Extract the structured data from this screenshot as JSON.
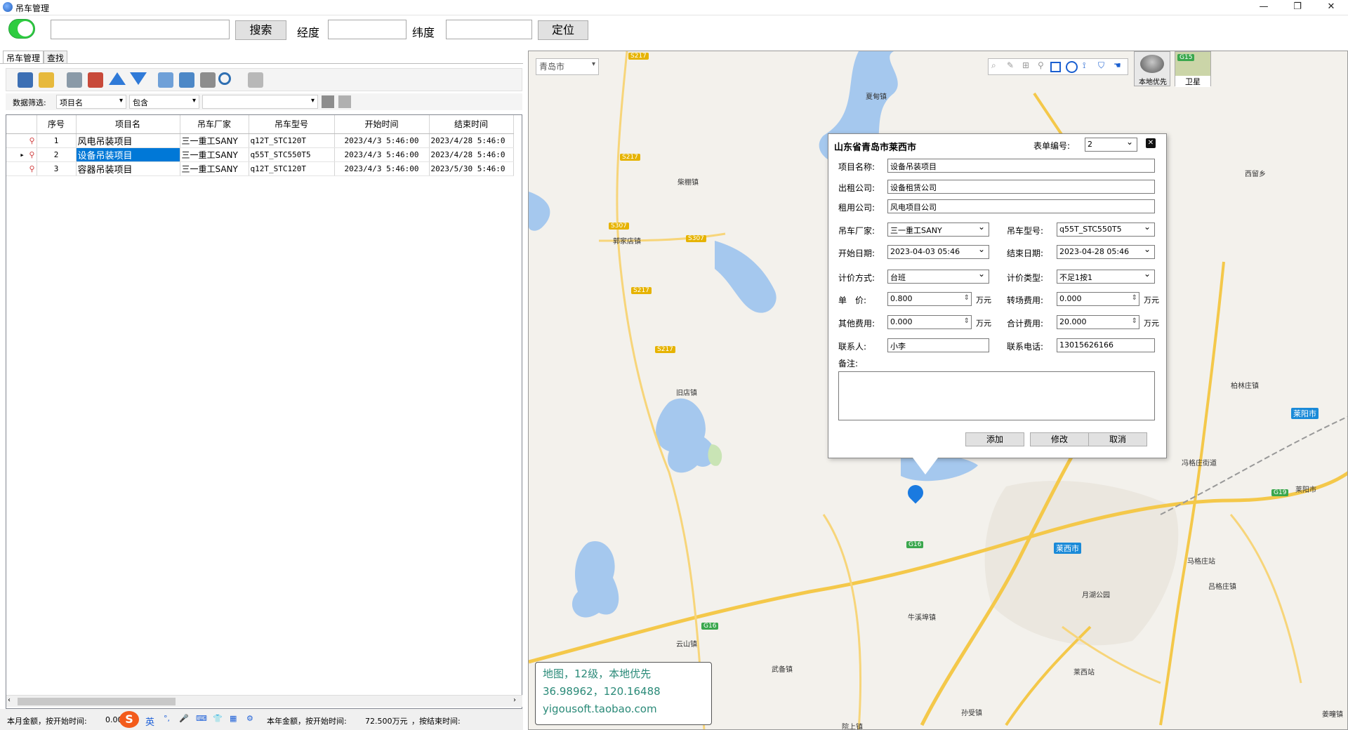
{
  "window": {
    "title": "吊车管理",
    "controls": [
      "—",
      "❐",
      "✕"
    ]
  },
  "toolbar": {
    "search_value": "",
    "search_button": "搜索",
    "lng_label": "经度",
    "lng_value": "",
    "lat_label": "纬度",
    "lat_value": "",
    "locate_button": "定位"
  },
  "tabs": [
    "吊车管理",
    "查找"
  ],
  "icon_toolbar": [
    "save-icon",
    "export-icon",
    "add-row-icon",
    "delete-row-icon",
    "move-up-icon",
    "move-down-icon",
    "refresh-icon",
    "sync-icon",
    "database-icon",
    "search-icon",
    "print-icon"
  ],
  "filter": {
    "label": "数据筛选:",
    "field": "项目名",
    "operator": "包含",
    "value": ""
  },
  "grid": {
    "columns": [
      "序号",
      "项目名",
      "吊车厂家",
      "吊车型号",
      "开始时间",
      "结束时间"
    ],
    "rows": [
      {
        "no": "1",
        "name": "风电吊装项目",
        "maker": "三一重工SANY",
        "model": "q12T_STC120T",
        "start": "2023/4/3 5:46:00",
        "end": "2023/4/28 5:46:0"
      },
      {
        "no": "2",
        "name": "设备吊装项目",
        "maker": "三一重工SANY",
        "model": "q55T_STC550T5",
        "start": "2023/4/3 5:46:00",
        "end": "2023/4/28 5:46:0"
      },
      {
        "no": "3",
        "name": "容器吊装项目",
        "maker": "三一重工SANY",
        "model": "q12T_STC120T",
        "start": "2023/4/3 5:46:00",
        "end": "2023/5/30 5:46:0"
      }
    ]
  },
  "status": {
    "month_label": "本月金额，按开始时间:",
    "month_value": "0.00",
    "year_label": "本年金额，按开始时间:",
    "year_value": "72.500万元",
    "end_label": "，按结束时间:",
    "ime": [
      "英",
      "°,",
      "🎤",
      "⌨",
      "👕",
      "▦",
      "⚙"
    ]
  },
  "map": {
    "city_select": "青岛市",
    "tools": [
      "zoom-icon",
      "ruler-icon",
      "measure-icon",
      "pin-icon",
      "rectangle-icon",
      "circle-icon",
      "polyline-icon",
      "shield-icon",
      "pan-icon"
    ],
    "local_first": "本地优先",
    "satellite": "卫星",
    "places": [
      "夏甸镇",
      "柴棚镇",
      "郭家店镇",
      "西留乡",
      "旧店镇",
      "柏林庄镇",
      "莱阳市",
      "冯格庄街道",
      "莱阳市",
      "莱西市",
      "马格庄站",
      "吕格庄镇",
      "月湖公园",
      "牛溪埠镇",
      "武备镇",
      "云山镇",
      "孙受镇",
      "莱西站",
      "院上镇",
      "姜疃镇"
    ],
    "info": {
      "line1": "地图，12级，本地优先",
      "line2": "36.98962，120.16488",
      "line3": "yigousoft.taobao.com"
    }
  },
  "dialog": {
    "title": "山东省青岛市莱西市",
    "form_no_label": "表单编号:",
    "form_no": "2",
    "project_label": "项目名称:",
    "project": "设备吊装项目",
    "lessor_label": "出租公司:",
    "lessor": "设备租赁公司",
    "lessee_label": "租用公司:",
    "lessee": "风电项目公司",
    "maker_label": "吊车厂家:",
    "maker": "三一重工SANY",
    "model_label": "吊车型号:",
    "model": "q55T_STC550T5",
    "start_label": "开始日期:",
    "start": "2023-04-03 05:46",
    "end_label": "结束日期:",
    "end": "2023-04-28 05:46",
    "pricing_label": "计价方式:",
    "pricing": "台班",
    "pricing_type_label": "计价类型:",
    "pricing_type": "不足1按1",
    "unit_price_label": "单　价:",
    "unit_price": "0.800",
    "transfer_label": "转场费用:",
    "transfer": "0.000",
    "other_label": "其他费用:",
    "other": "0.000",
    "total_label": "合计费用:",
    "total": "20.000",
    "unit": "万元",
    "contact_label": "联系人:",
    "contact": "小李",
    "phone_label": "联系电话:",
    "phone": "13015626166",
    "note_label": "备注:",
    "note": "",
    "add_button": "添加",
    "edit_button": "修改",
    "cancel_button": "取消"
  }
}
